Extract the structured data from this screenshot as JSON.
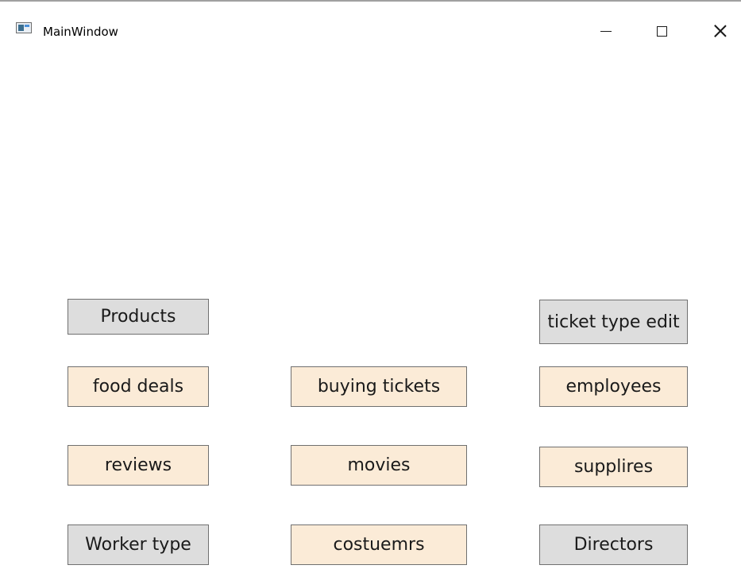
{
  "window": {
    "title": "MainWindow",
    "controls": {
      "minimize_icon": "minimize-icon",
      "maximize_icon": "maximize-icon",
      "close_icon": "close-icon"
    }
  },
  "colors": {
    "button_gray": "#dddddd",
    "button_peach": "#fbebd7",
    "button_border": "#707070"
  },
  "buttons": {
    "products": "Products",
    "ticket_type_edit": "ticket type edit",
    "food_deals": "food deals",
    "buying_tickets": "buying tickets",
    "employees": "employees",
    "reviews": "reviews",
    "movies": "movies",
    "supplires": "supplires",
    "worker_type": "Worker type",
    "costuemrs": "costuemrs",
    "directors": "Directors"
  }
}
